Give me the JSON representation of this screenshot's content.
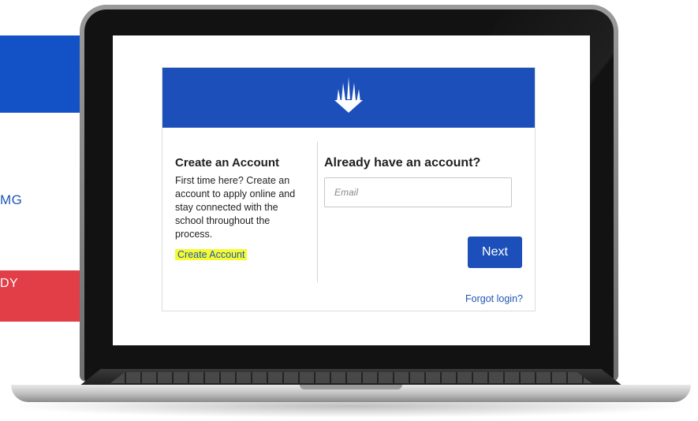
{
  "background": {
    "partial_link_text": "MG",
    "partial_button_text": "DY"
  },
  "login": {
    "logo_icon": "crown-spikes-logo-icon",
    "create": {
      "title": "Create an Account",
      "description": "First time here? Create an account to apply online and stay connected with the school throughout the process.",
      "link_label": "Create Account"
    },
    "signin": {
      "title": "Already have an account?",
      "email_placeholder": "Email",
      "email_value": "",
      "next_label": "Next",
      "forgot_label": "Forgot login?"
    }
  },
  "colors": {
    "brand_blue": "#1d4fba",
    "link_blue": "#1f56b8",
    "highlight_yellow": "#f6fb2f",
    "background_red": "#e23e48"
  }
}
